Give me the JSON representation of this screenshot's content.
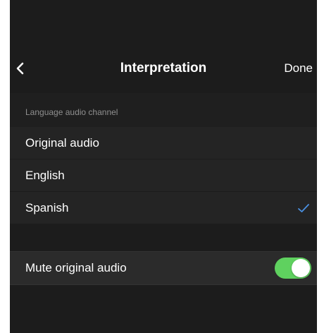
{
  "nav": {
    "title": "Interpretation",
    "done_label": "Done"
  },
  "section": {
    "label": "Language audio channel"
  },
  "channels": [
    {
      "label": "Original audio",
      "selected": false
    },
    {
      "label": "English",
      "selected": false
    },
    {
      "label": "Spanish",
      "selected": true
    }
  ],
  "mute": {
    "label": "Mute original audio",
    "enabled": true
  },
  "colors": {
    "accent_check": "#4a90e2",
    "toggle_on": "#5fd15f",
    "background": "#1c1c1c"
  },
  "icons": {
    "back": "chevron-left-icon",
    "selected": "checkmark-icon"
  }
}
